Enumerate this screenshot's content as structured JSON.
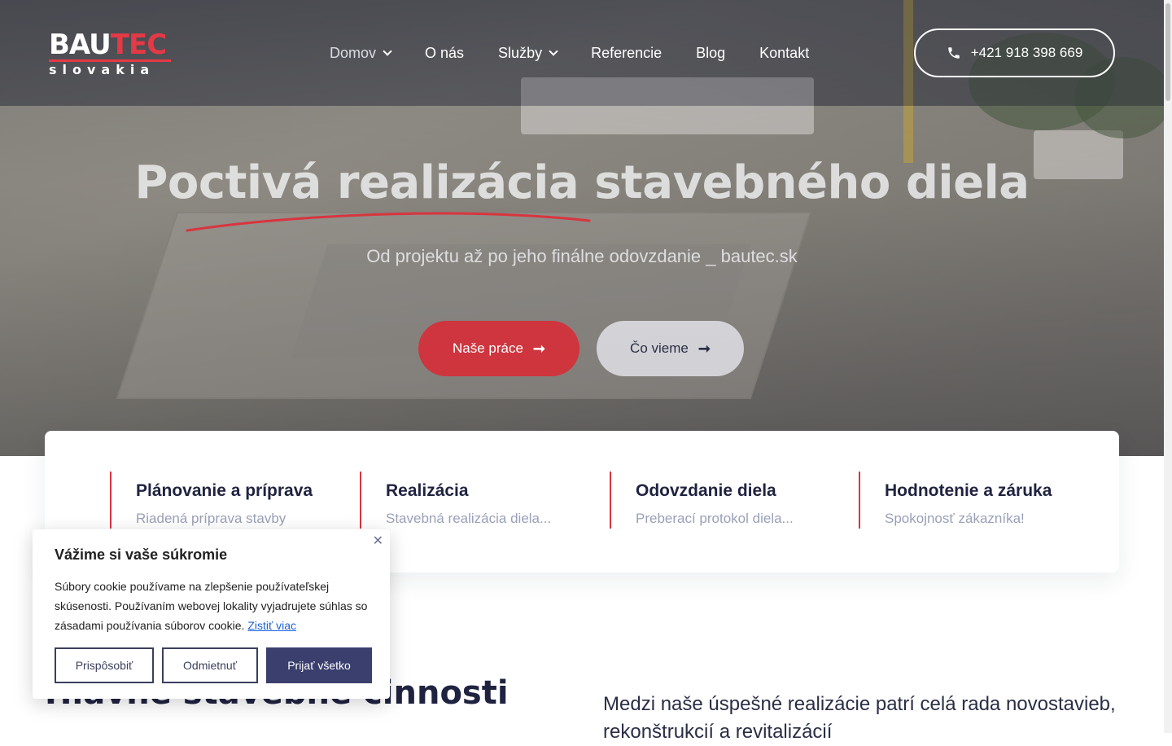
{
  "brand": {
    "logo_line1_a": "BAU",
    "logo_line1_b": "TEC",
    "logo_line2": "slovakia"
  },
  "nav": {
    "items": [
      {
        "label": "Domov",
        "has_dropdown": true,
        "active": true
      },
      {
        "label": "O nás",
        "has_dropdown": false
      },
      {
        "label": "Služby",
        "has_dropdown": true
      },
      {
        "label": "Referencie",
        "has_dropdown": false
      },
      {
        "label": "Blog",
        "has_dropdown": false
      },
      {
        "label": "Kontakt",
        "has_dropdown": false
      }
    ],
    "phone": "+421 918 398 669"
  },
  "hero": {
    "title": "Poctivá realizácia stavebného diela",
    "subtitle": "Od projektu až po jeho finálne odovzdanie _ bautec.sk",
    "primary_button": "Naše práce",
    "secondary_button": "Čo vieme"
  },
  "features": [
    {
      "title": "Plánovanie a príprava",
      "desc": "Riadená príprava stavby"
    },
    {
      "title": "Realizácia",
      "desc": "Stavebná realizácia diela..."
    },
    {
      "title": "Odovzdanie diela",
      "desc": "Preberací protokol diela..."
    },
    {
      "title": "Hodnotenie a záruka",
      "desc": "Spokojnosť zákazníka!"
    }
  ],
  "section": {
    "title": "Hlavné stavebné činnosti",
    "text": "Medzi naše úspešné realizácie patrí celá rada novostavieb, rekonštrukcií a revitalizácií"
  },
  "cookie": {
    "title": "Vážime si vaše súkromie",
    "text": "Súbory cookie používame na zlepšenie používateľskej skúsenosti. Používaním webovej lokality vyjadrujete súhlas so zásadami používania súborov cookie.",
    "link": "Zistiť viac",
    "customize": "Prispôsobiť",
    "reject": "Odmietnuť",
    "accept": "Prijať všetko"
  },
  "colors": {
    "accent_red": "#d8353f",
    "navy": "#1f2340",
    "cookie_primary": "#3a3f6e"
  }
}
